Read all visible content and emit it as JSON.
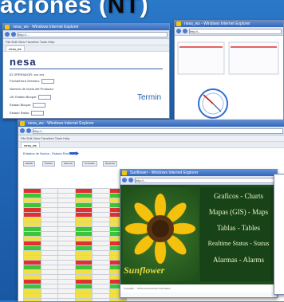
{
  "slide": {
    "title_prefix": "aciones (",
    "title_strong": "NT",
    "title_suffix": ")"
  },
  "window1": {
    "titlebar": "nesa_ws - Windows Internet Explorer",
    "url": "http://...",
    "menu": "File  Edit  View  Favorites  Tools  Help",
    "tab": "nesa_ws",
    "logo": "nesa",
    "side_text": "Termin",
    "rows": [
      "ID OPERADOR:   xxx  xxx",
      "Fecha/Hora Servidor:",
      "Numero de Vuelo del Producto:",
      "Ult. Estado Bloque:",
      "Estado Bloque:",
      "Estado Radio:"
    ]
  },
  "window2": {
    "titlebar": "nesa_ws - Windows Internet Explorer",
    "url": "http://..."
  },
  "window3": {
    "titlebar": "nesa_ws - Windows Internet Explorer",
    "url": "http://...",
    "menu": "File  Edit  View  Favorites  Tools  Help",
    "tab": "nesa_ws",
    "section_label": "Estados de Nodos  -  Estado Red",
    "buttons": [
      "Estado",
      "Niveles",
      "Alarmas",
      "Consolas",
      "Reportes"
    ]
  },
  "window4": {
    "titlebar": "Sunflower - Windows Internet Explorer",
    "url": "http://...",
    "menu_lines": [
      "Graficos - Charts",
      "Mapas (GIS) - Maps",
      "Tablas - Tables",
      "Realtime Status - Status",
      "Alarmas - Alarms"
    ],
    "brand": "Sunflower",
    "footer": "Copyright ... Todos los derechos reservados"
  },
  "colors": {
    "background": "#1e63b2",
    "title_bar": "#3767b8",
    "sunflower_panel": "#184218",
    "status_red": "#e03030",
    "status_green": "#3cc43c",
    "status_yellow": "#f0e040"
  }
}
